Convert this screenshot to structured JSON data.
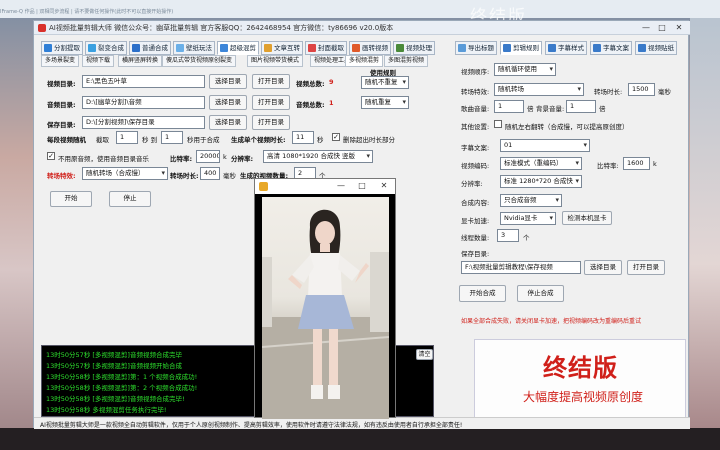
{
  "background": {
    "top_text": "终结版",
    "top_small": "IFrame-Q 作品 | 双相同步流程 | 请不要做任何操作(此时不可以直接开始操作)"
  },
  "window": {
    "title": "AI视频批量剪辑大师  微信公众号：幽草批量剪辑  官方客服QQ：2642468954  官方微信：ty86696  v20.0版本",
    "min": "—",
    "max": "□",
    "close": "✕"
  },
  "tabs": [
    "分割提取",
    "裂变合成",
    "普通合成",
    "壁纸玩法",
    "超级混剪",
    "文章互转",
    "封面截取",
    "画转视频",
    "视频处理"
  ],
  "right_tabs": [
    "导出标题",
    "剪辑规则",
    "字幕样式",
    "字幕文案",
    "视频贴纸"
  ],
  "subtabs_row1": [
    "多场景裂变",
    "视频下载",
    "横屏竖屏转换",
    "傻瓜式带货视频原创裂变",
    "图片视频带货模式",
    "视频处理工具",
    "多视频混剪",
    "多图混剪视频"
  ],
  "form": {
    "video_dir_label": "视频目录:",
    "video_dir_value": "E:\\黑色五叶草",
    "audio_dir_label": "音频目录:",
    "audio_dir_value": "D:\\[幽草分割]\\音频",
    "save_dir_label": "保存目录:",
    "save_dir_value": "D:\\[分割视频]\\保存目录",
    "pick_dir": "选择目录",
    "open_dir": "打开目录",
    "video_total_label": "视频总数:",
    "video_total": "9",
    "audio_total_label": "音频总数:",
    "audio_total": "1",
    "use_rule_label": "使用规则",
    "rule1": "随机不重复",
    "rule2": "随机重复",
    "clip_label": "每段视频随机",
    "cut_label": "截取",
    "cut_from": "1",
    "sec_to": "秒 到",
    "cut_to": "1",
    "sec_merge": "秒用于合成",
    "gen_single_label": "生成单个视频时长:",
    "gen_single": "11",
    "sec": "秒",
    "cut_excess": "删除超出时长部分",
    "no_orig_audio": "不用原音频，使用音频目录音乐",
    "bitrate_label": "比特率:",
    "bitrate": "20000",
    "k": "k",
    "resolution_label": "分辨率:",
    "resolution": "高清 1080*1920 合成快 竖版",
    "transition_label": "转场特效:",
    "transition": "随机转场（合成慢）",
    "transition_dur_label": "转场时长:",
    "transition_dur": "400",
    "ms": "毫秒",
    "gen_count_label": "生成的视频数量:",
    "gen_count": "2",
    "ge": "个",
    "start": "开始",
    "stop": "停止"
  },
  "log": {
    "clear": "清空",
    "lines": [
      "13时50分57秒 [多视频混剪]音频视频合成完毕",
      "13时50分57秒 [多视频混剪]音频视频开始合成",
      "13时50分58秒 [多视频混剪]第：1 个视频合成成功!",
      "13时50分58秒 [多视频混剪]第：2 个视频合成成功!",
      "13时50分58秒 [多视频混剪]音频视频合成完毕!",
      "13时50分58秒 多视频混剪任务执行完毕!"
    ]
  },
  "right": {
    "video_order_label": "视频顺序:",
    "video_order": "随机循环使用",
    "transition_label": "转场特效:",
    "transition": "随机转场",
    "transition_dur_label": "转场时长:",
    "transition_dur": "1500",
    "ms": "毫秒",
    "music_vol_label": "歌曲音量:",
    "music_vol": "1",
    "times": "倍",
    "bg_vol_label": "背景音量:",
    "bg_vol": "1",
    "other_label": "其他设置:",
    "mirror": "随机左右翻转（合成慢，可以提高原创度）",
    "subtitle_label": "字幕文案:",
    "subtitle": "01",
    "encode_label": "视频编码:",
    "encode": "标准模式（重编码）",
    "bitrate_label": "比特率:",
    "bitrate": "1600",
    "k": "k",
    "res_label": "分辨率:",
    "res": "标准 1280*720 合成快",
    "content_label": "合成内容:",
    "content": "只合成音频",
    "gpu_label": "显卡加速:",
    "gpu": "Nvidia显卡",
    "gpu_detect": "检测本机显卡",
    "threads_label": "线程数量:",
    "threads": "3",
    "ge": "个",
    "save_dir_label": "保存目录:",
    "save_dir": "F:\\视频批量剪辑教程\\保存视频",
    "pick_dir": "选择目录",
    "open_dir": "打开目录",
    "start": "开始合成",
    "stop": "停止合成",
    "warning": "如果全部合成失败，请关闭显卡加速，把视频编码改为重编码后重试"
  },
  "promo": {
    "title": "终结版",
    "subtitle": "大幅度提高视频原创度"
  },
  "status": "AI视频批量剪辑大师是一款视频全自动剪辑软件，仅用于个人原创视频制作、提高剪辑效率，使用软件时请遵守法律法规，如有违反由使用者自行承担全部责任!",
  "player": {
    "title": "",
    "min": "—",
    "max": "□",
    "close": "✕"
  },
  "colors": {
    "accent": "#d0201a",
    "log_text": "#2ee02e"
  }
}
